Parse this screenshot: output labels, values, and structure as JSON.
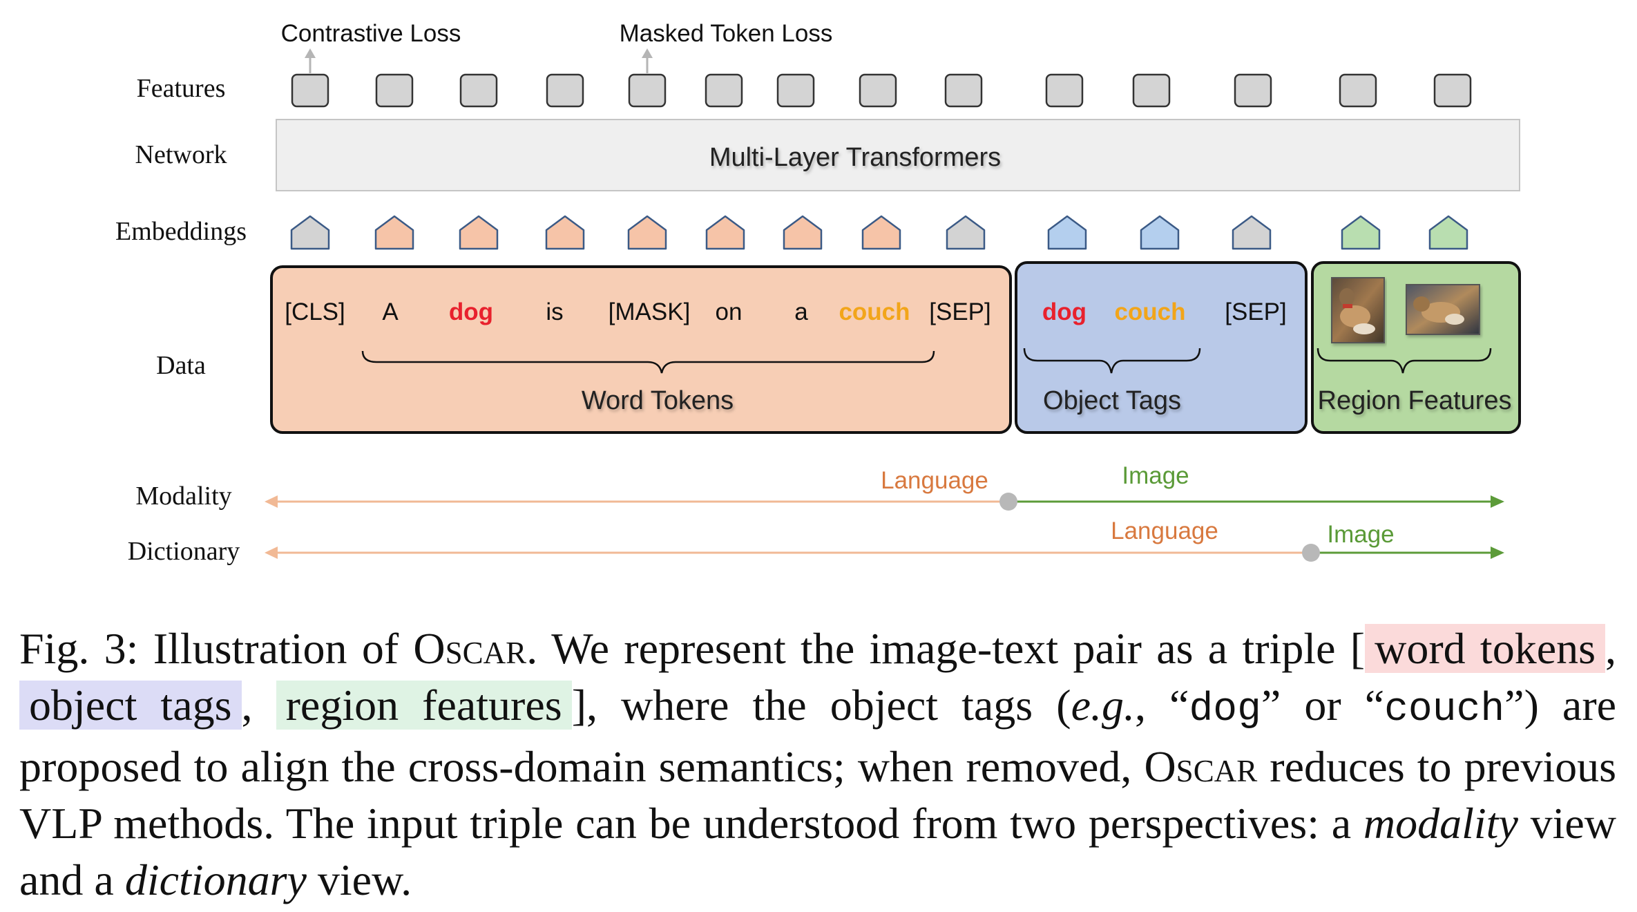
{
  "rows": {
    "features": "Features",
    "network": "Network",
    "embeddings": "Embeddings",
    "data": "Data",
    "modality": "Modality",
    "dictionary": "Dictionary"
  },
  "losses": {
    "contrastive": "Contrastive Loss",
    "masked": "Masked Token Loss"
  },
  "network_label": "Multi-Layer Transformers",
  "word_tokens": [
    "[CLS]",
    "A",
    "dog",
    "is",
    "[MASK]",
    "on",
    "a",
    "couch",
    "[SEP]"
  ],
  "object_tokens": [
    "dog",
    "couch",
    "[SEP]"
  ],
  "groups": {
    "word_tokens": "Word Tokens",
    "object_tags": "Object Tags",
    "region_features": "Region Features"
  },
  "modality_axis": {
    "language": "Language",
    "image": "Image"
  },
  "dictionary_axis": {
    "language": "Language",
    "image": "Image"
  },
  "colors": {
    "word_fill": "#f7ceb5",
    "object_fill": "#b9c9e8",
    "region_fill": "#b5d9a1",
    "grey_fill": "#d3d3d3",
    "orange_embed": "#f6c4a8",
    "blue_embed": "#b4cfee",
    "green_embed": "#b9deb0",
    "red_token": "#e8212d",
    "orange_token": "#f2a51a",
    "language_label": "#d8793f",
    "image_label": "#5a9a37",
    "language_line": "#f1b995",
    "image_line": "#5c9b39"
  },
  "caption": {
    "fig": "Fig. 3:",
    "t1": " Illustration of ",
    "oscar": "Oscar",
    "t2": ". We represent the image-text pair as a triple [",
    "hl_word": "word tokens",
    "sep1": ", ",
    "hl_obj": "object tags",
    "sep2": ", ",
    "hl_reg": "region features",
    "t3": "], where the object tags (",
    "eg": "e.g.",
    "t4": ", “",
    "code_dog": "dog",
    "t5": "” or “",
    "code_couch": "couch",
    "t6": "”) are proposed to align the cross-domain semantics; when removed, ",
    "oscar2": "Oscar",
    "t7": " reduces to previous VLP methods. The input triple can be understood from two perspectives: a ",
    "modality_word": "modality",
    "t8": " view and a ",
    "dictionary_word": "dictionary",
    "t9": " view."
  }
}
